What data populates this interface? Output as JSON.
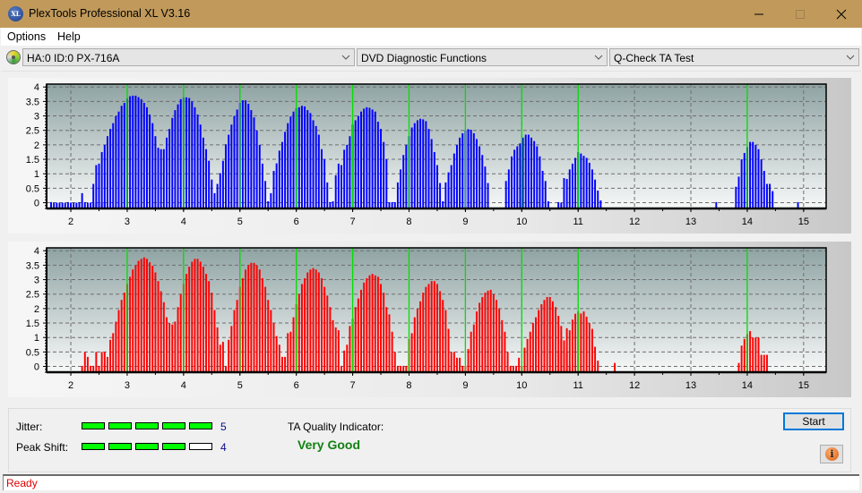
{
  "window": {
    "title": "PlexTools Professional XL V3.16",
    "app_icon_text": "XL",
    "minimize_icon": "minimize-icon",
    "maximize_icon": "maximize-icon",
    "close_icon": "close-icon"
  },
  "menu": {
    "items": [
      {
        "label": "Options"
      },
      {
        "label": "Help"
      }
    ]
  },
  "toolbar": {
    "drive_icon": "disc-drive-icon",
    "drive_select": "HA:0 ID:0  PX-716A",
    "function_select": "DVD Diagnostic Functions",
    "test_select": "Q-Check TA Test"
  },
  "chart_data": [
    {
      "type": "bar",
      "name": "TA histogram (blue)",
      "color": "#0000ff",
      "title": "",
      "xlabel": "",
      "ylabel": "",
      "xlim": [
        1.57,
        15.4
      ],
      "ylim": [
        -0.2,
        4.1
      ],
      "xticks": [
        "2",
        "3",
        "4",
        "5",
        "6",
        "7",
        "8",
        "9",
        "10",
        "11",
        "12",
        "13",
        "14",
        "15"
      ],
      "yticks": [
        "0",
        "0.5",
        "1",
        "1.5",
        "2",
        "2.5",
        "3",
        "3.5",
        "4"
      ],
      "reference_lines": [
        3,
        4,
        5,
        6,
        7,
        8,
        9,
        10,
        11,
        14
      ],
      "grid": true,
      "bar_step": 0.05,
      "segments": [
        {
          "x0": 1.65,
          "values": [
            0.02,
            0,
            0,
            0,
            0,
            0,
            0.02,
            0,
            0,
            0,
            0.02,
            0.33,
            0.02,
            0,
            0,
            0.02,
            0,
            0.02,
            0,
            0.02
          ]
        },
        {
          "x0": 2.4,
          "values": [
            0.65,
            1.3,
            1.35,
            1.75,
            2.0,
            2.3,
            2.55,
            2.75,
            3.0,
            3.15,
            3.35,
            3.45,
            3.6,
            3.68,
            3.7,
            3.7,
            3.65,
            3.58,
            3.45,
            3.3,
            3.05,
            2.75,
            2.3,
            1.9,
            1.85,
            1.85,
            2.25,
            2.55,
            2.93,
            3.2,
            3.4,
            3.58,
            3.64,
            3.64,
            3.62,
            3.5,
            3.3,
            3.05,
            2.7,
            2.25,
            1.85,
            1.45,
            0.8,
            0.33,
            0.65,
            1.02,
            1.45,
            2.02,
            2.35,
            2.7,
            3.0,
            3.22,
            3.45,
            3.54,
            3.54,
            3.42,
            3.2,
            2.95,
            2.5,
            2.0,
            1.35,
            0.75,
            0.05,
            0.33,
            1.1,
            1.36,
            1.8,
            2.1,
            2.45,
            2.75,
            2.98,
            3.15,
            3.27,
            3.3,
            3.35,
            3.33,
            3.2,
            3.1,
            2.85,
            2.65,
            2.35,
            1.85,
            1.5,
            0.7,
            0.02,
            0.05,
            0.95,
            1.35,
            1.3,
            1.83,
            2.0,
            2.3,
            2.7,
            2.85,
            3.0,
            3.15,
            3.25,
            3.3,
            3.28,
            3.22,
            3.15,
            2.8,
            2.55,
            2.1,
            1.5,
            0.02,
            0.02,
            0.02,
            0.7,
            1.15,
            1.65,
            2.0,
            2.3,
            2.6,
            2.75,
            2.85,
            2.9,
            2.88,
            2.82,
            2.55,
            2.2,
            1.75,
            1.3,
            0.68,
            0.05,
            0.7,
            1.05,
            1.3,
            1.7,
            2.0,
            2.25,
            2.4,
            2.5,
            2.54,
            2.52,
            2.4,
            2.2,
            1.95,
            1.65,
            1.25,
            0.68
          ]
        },
        {
          "x0": 9.72,
          "values": [
            0.75,
            1.15,
            1.6,
            1.83,
            1.95,
            2.05,
            2.25,
            2.35,
            2.35,
            2.25,
            2.13,
            1.95,
            1.6,
            1.1,
            0.75,
            0.05
          ]
        },
        {
          "x0": 10.65,
          "values": [
            0.02,
            0,
            0.85,
            0.82,
            1.15,
            1.35,
            1.55,
            1.75,
            1.7,
            1.62,
            1.55,
            1.38,
            1.15,
            0.8,
            0.42,
            0.08
          ]
        },
        {
          "x0": 13.45,
          "values": [
            0.02
          ]
        },
        {
          "x0": 13.8,
          "values": [
            0.55,
            0.9,
            1.5,
            1.72,
            1.92,
            2.1,
            2.1,
            2.0,
            1.85,
            1.5,
            1.1,
            0.65,
            0.65,
            0.4
          ]
        },
        {
          "x0": 14.9,
          "values": [
            0.02
          ]
        }
      ]
    },
    {
      "type": "bar",
      "name": "TA histogram (red)",
      "color": "#ff0000",
      "title": "",
      "xlabel": "",
      "ylabel": "",
      "xlim": [
        1.57,
        15.4
      ],
      "ylim": [
        -0.2,
        4.1
      ],
      "xticks": [
        "2",
        "3",
        "4",
        "5",
        "6",
        "7",
        "8",
        "9",
        "10",
        "11",
        "12",
        "13",
        "14",
        "15"
      ],
      "yticks": [
        "0",
        "0.5",
        "1",
        "1.5",
        "2",
        "2.5",
        "3",
        "3.5",
        "4"
      ],
      "reference_lines": [
        3,
        4,
        5,
        6,
        7,
        8,
        9,
        10,
        11,
        14
      ],
      "grid": true,
      "bar_step": 0.05,
      "segments": [
        {
          "x0": 2.2,
          "values": [
            0.02,
            0.5,
            0.33,
            0.02,
            0.02,
            0.5,
            0.02,
            0.5,
            0.5,
            0.33,
            0.92,
            1.15,
            1.55,
            1.95,
            2.3,
            2.55,
            2.85,
            3.1,
            3.35,
            3.5,
            3.65,
            3.72,
            3.77,
            3.72,
            3.6,
            3.48,
            3.25,
            2.95,
            2.6,
            2.22,
            1.7,
            1.5,
            1.45,
            1.55,
            2.05,
            2.5,
            2.85,
            3.2,
            3.45,
            3.62,
            3.72,
            3.72,
            3.62,
            3.45,
            3.2,
            2.95,
            2.55,
            1.95,
            1.35,
            0.75,
            0.85,
            0.02,
            0.92,
            1.4,
            1.95,
            2.3,
            2.75,
            3.05,
            3.35,
            3.5,
            3.58,
            3.58,
            3.5,
            3.35,
            3.05,
            2.75,
            2.3,
            1.95,
            1.5,
            1.05,
            0.75,
            0.33,
            0.33,
            1.15,
            1.2,
            1.7,
            2.15,
            2.5,
            2.85,
            3.05,
            3.25,
            3.35,
            3.4,
            3.35,
            3.25,
            3.05,
            2.75,
            2.45,
            2.05,
            1.6,
            1.35,
            1.25,
            0.02,
            0.55,
            0.75,
            1.4,
            1.65,
            2.05,
            2.35,
            2.65,
            2.9,
            3.05,
            3.15,
            3.2,
            3.15,
            3.1,
            2.85,
            2.55,
            2.05,
            1.8,
            1.2,
            0.5,
            0.02,
            0.02,
            0.02,
            0.02,
            0.95,
            1.15,
            1.7,
            2.0,
            2.25,
            2.55,
            2.75,
            2.85,
            2.95,
            2.95,
            2.85,
            2.6,
            2.3,
            1.95,
            1.3,
            0.5,
            0.5,
            0.3,
            0.3,
            0.02,
            0.02,
            0.6,
            1.2,
            1.45,
            1.9,
            2.2,
            2.4,
            2.55,
            2.62,
            2.65,
            2.5,
            2.3,
            2.0,
            1.6,
            1.2,
            0.5,
            0.02,
            0.02,
            0.02,
            0.3,
            0.02,
            0.65,
            0.95,
            1.2,
            1.5,
            1.7,
            1.95,
            2.15,
            2.3,
            2.4,
            2.4,
            2.25,
            2.05,
            1.75,
            1.4,
            0.9,
            0.5,
            0.02
          ]
        },
        {
          "x0": 10.65,
          "values": [
            0.55,
            0.95,
            0.65,
            1.32,
            1.25,
            1.62,
            1.82,
            1.9,
            1.83,
            1.9,
            1.72,
            1.5,
            1.3,
            0.68,
            0.2
          ]
        },
        {
          "x0": 11.65,
          "values": [
            0.12
          ]
        },
        {
          "x0": 13.85,
          "values": [
            0.12,
            0.72,
            0.95,
            1.12,
            1.22,
            1.0,
            1.0,
            1.0,
            0.4,
            0.4,
            0.4
          ]
        }
      ]
    }
  ],
  "metrics": {
    "jitter_label": "Jitter:",
    "jitter_value": "5",
    "jitter_score": 5,
    "jitter_max": 5,
    "peak_shift_label": "Peak Shift:",
    "peak_shift_value": "4",
    "peak_shift_score": 4,
    "peak_shift_max": 5,
    "quality_label": "TA Quality Indicator:",
    "quality_value": "Very Good"
  },
  "buttons": {
    "start": "Start",
    "info_icon": "info-icon"
  },
  "status": {
    "text": "Ready"
  }
}
